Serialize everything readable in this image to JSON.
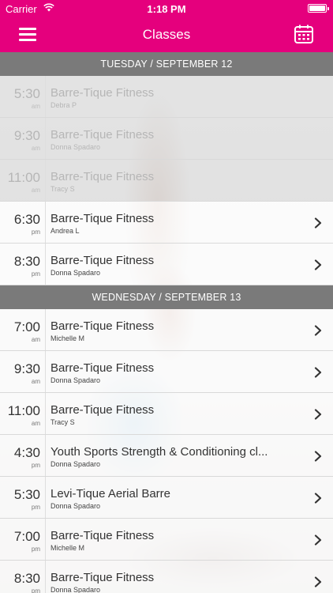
{
  "status_bar": {
    "carrier": "Carrier",
    "time": "1:18 PM",
    "wifi_icon": "wifi-icon",
    "battery_level": 1.0
  },
  "nav": {
    "title": "Classes",
    "menu_icon": "hamburger-menu-icon",
    "calendar_icon": "calendar-icon"
  },
  "colors": {
    "accent": "#e5007d",
    "section_header": "#7a7a7a"
  },
  "sections": [
    {
      "header": "TUESDAY / SEPTEMBER 12",
      "classes": [
        {
          "time": "5:30",
          "ampm": "am",
          "name": "Barre-Tique Fitness",
          "instructor": "Debra P",
          "past": true
        },
        {
          "time": "9:30",
          "ampm": "am",
          "name": "Barre-Tique Fitness",
          "instructor": "Donna Spadaro",
          "past": true
        },
        {
          "time": "11:00",
          "ampm": "am",
          "name": "Barre-Tique Fitness",
          "instructor": "Tracy S",
          "past": true
        },
        {
          "time": "6:30",
          "ampm": "pm",
          "name": "Barre-Tique Fitness",
          "instructor": "Andrea L",
          "past": false
        },
        {
          "time": "8:30",
          "ampm": "pm",
          "name": "Barre-Tique Fitness",
          "instructor": "Donna Spadaro",
          "past": false
        }
      ]
    },
    {
      "header": "WEDNESDAY / SEPTEMBER 13",
      "classes": [
        {
          "time": "7:00",
          "ampm": "am",
          "name": "Barre-Tique Fitness",
          "instructor": "Michelle M",
          "past": false
        },
        {
          "time": "9:30",
          "ampm": "am",
          "name": "Barre-Tique Fitness",
          "instructor": "Donna Spadaro",
          "past": false
        },
        {
          "time": "11:00",
          "ampm": "am",
          "name": "Barre-Tique Fitness",
          "instructor": "Tracy S",
          "past": false
        },
        {
          "time": "4:30",
          "ampm": "pm",
          "name": "Youth Sports Strength & Conditioning cl...",
          "instructor": "Donna Spadaro",
          "past": false
        },
        {
          "time": "5:30",
          "ampm": "pm",
          "name": "Levi-Tique Aerial Barre",
          "instructor": "Donna Spadaro",
          "past": false
        },
        {
          "time": "7:00",
          "ampm": "pm",
          "name": "Barre-Tique Fitness",
          "instructor": "Michelle M",
          "past": false
        },
        {
          "time": "8:30",
          "ampm": "pm",
          "name": "Barre-Tique Fitness",
          "instructor": "Donna Spadaro",
          "past": false
        }
      ]
    }
  ]
}
